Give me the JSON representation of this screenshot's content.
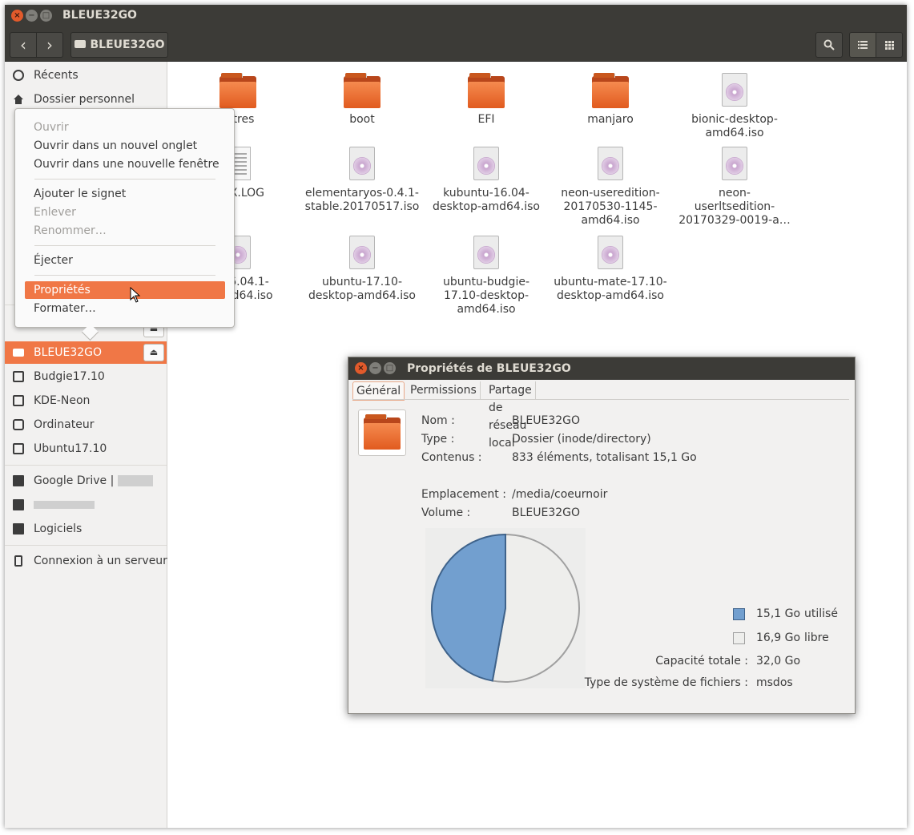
{
  "window": {
    "title": "BLEUE32GO",
    "close_glyph": "×",
    "min_glyph": "−",
    "max_glyph": "□"
  },
  "toolbar": {
    "back_glyph": "‹",
    "forward_glyph": "›",
    "breadcrumb": "BLEUE32GO",
    "search_glyph": "🔍",
    "list_glyph": "☰",
    "grid_glyph": "⁞⁞⁞"
  },
  "sidebar": {
    "items": [
      {
        "label": "Récents",
        "icon": "clock-icon"
      },
      {
        "label": "Dossier personnel",
        "icon": "home-icon"
      },
      {
        "label": "BLEUE32GO",
        "icon": "usb-drive-icon",
        "selected": true,
        "eject": "⏏"
      },
      {
        "label": "Budgie17.10",
        "icon": "drive-icon"
      },
      {
        "label": "KDE-Neon",
        "icon": "drive-icon"
      },
      {
        "label": "Ordinateur",
        "icon": "computer-icon"
      },
      {
        "label": "Ubuntu17.10",
        "icon": "drive-icon"
      },
      {
        "label": "Google Drive |",
        "icon": "folder-icon"
      },
      {
        "label": "",
        "icon": "folder-icon"
      },
      {
        "label": "Logiciels",
        "icon": "folder-icon"
      },
      {
        "label": "Connexion à un serveur",
        "icon": "server-icon"
      }
    ]
  },
  "files": [
    {
      "name": "…tres",
      "type": "folder"
    },
    {
      "name": "boot",
      "type": "folder"
    },
    {
      "name": "EFI",
      "type": "folder"
    },
    {
      "name": "manjaro",
      "type": "folder"
    },
    {
      "name": "bionic-desktop-amd64.iso",
      "type": "iso"
    },
    {
      "name": "…EX.LOG",
      "type": "log"
    },
    {
      "name": "elementaryos-0.4.1-stable.20170517.iso",
      "type": "iso"
    },
    {
      "name": "kubuntu-16.04-desktop-amd64.iso",
      "type": "iso"
    },
    {
      "name": "neon-useredition-20170530-1145-amd64.iso",
      "type": "iso"
    },
    {
      "name": "neon-userltsedition-20170329-0019-a…",
      "type": "iso"
    },
    {
      "name": "…-16.04.1-…amd64.iso",
      "type": "iso"
    },
    {
      "name": "ubuntu-17.10-desktop-amd64.iso",
      "type": "iso"
    },
    {
      "name": "ubuntu-budgie-17.10-desktop-amd64.iso",
      "type": "iso"
    },
    {
      "name": "ubuntu-mate-17.10-desktop-amd64.iso",
      "type": "iso"
    }
  ],
  "file_labels": [
    [
      "…tres"
    ],
    [
      "boot"
    ],
    [
      "EFI"
    ],
    [
      "manjaro"
    ],
    [
      "bionic-desktop-",
      "amd64.iso"
    ],
    [
      "…EX.LOG"
    ],
    [
      "elementaryos-0.4.1-",
      "stable.20170517.iso"
    ],
    [
      "kubuntu-16.04-",
      "desktop-amd64.iso"
    ],
    [
      "neon-useredition-",
      "20170530-1145-",
      "amd64.iso"
    ],
    [
      "neon-",
      "userltsedition-",
      "20170329-0019-a…"
    ],
    [
      "…-16.04.1-",
      "…amd64.iso"
    ],
    [
      "ubuntu-17.10-",
      "desktop-amd64.iso"
    ],
    [
      "ubuntu-budgie-",
      "17.10-desktop-",
      "amd64.iso"
    ],
    [
      "ubuntu-mate-17.10-",
      "desktop-amd64.iso"
    ]
  ],
  "context_menu": {
    "open": "Ouvrir",
    "open_tab": "Ouvrir dans un nouvel onglet",
    "open_window": "Ouvrir dans une nouvelle fenêtre",
    "bookmark": "Ajouter le signet",
    "remove": "Enlever",
    "rename": "Renommer…",
    "eject": "Éjecter",
    "properties": "Propriétés",
    "format": "Formater…"
  },
  "dialog": {
    "title": "Propriétés de BLEUE32GO",
    "tabs": [
      "Général",
      "Permissions",
      "Partage de réseau local"
    ],
    "name_label": "Nom :",
    "name_value": "BLEUE32GO",
    "type_label": "Type :",
    "type_value": "Dossier (inode/directory)",
    "contents_label": "Contenus :",
    "contents_value": "833 éléments, totalisant 15,1 Go",
    "location_label": "Emplacement :",
    "location_value": "/media/coeurnoir",
    "volume_label": "Volume :",
    "volume_value": "BLEUE32GO",
    "used_value": "15,1 Go",
    "used_label": "utilisé",
    "free_value": "16,9 Go",
    "free_label": "libre",
    "capacity_label": "Capacité totale :",
    "capacity_value": "32,0 Go",
    "fs_label": "Type de système de fichiers :",
    "fs_value": "msdos"
  },
  "usage": {
    "used_gb": 15.1,
    "free_gb": 16.9,
    "used_color": "#729fcf",
    "free_color": "#eeeeec"
  },
  "colors": {
    "accent": "#f07746",
    "titlebar": "#3c3b37"
  }
}
